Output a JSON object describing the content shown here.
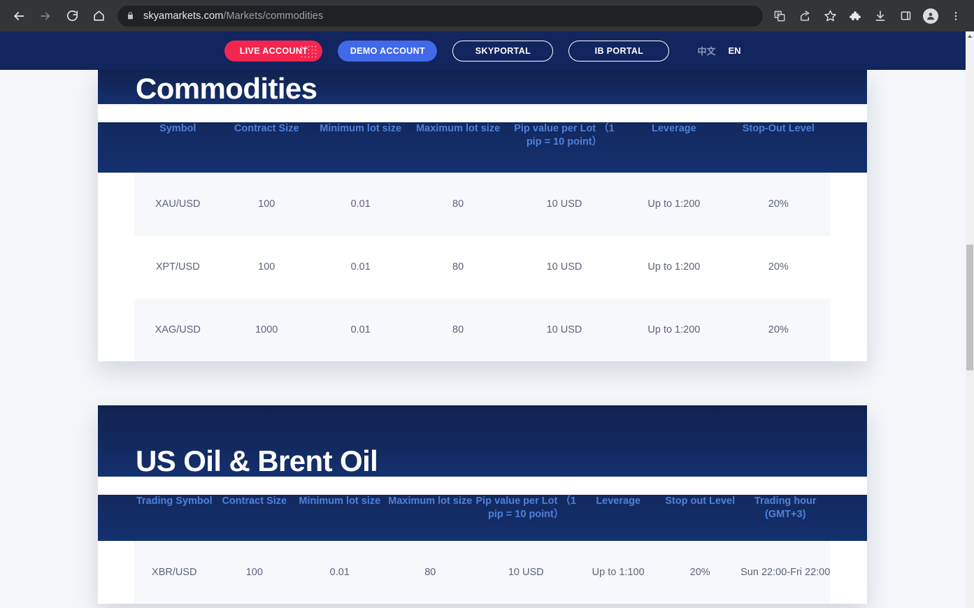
{
  "browser": {
    "back_icon": "back-arrow-icon",
    "forward_icon": "forward-arrow-icon",
    "reload_icon": "reload-icon",
    "home_icon": "home-icon",
    "lock_icon": "lock-icon",
    "url_host": "skyamarkets.com",
    "url_path": "/Markets/commodities",
    "url_full": "skyamarkets.com/Markets/commodities",
    "toolbar_icons": [
      "translate-icon",
      "share-icon",
      "bookmark-star-icon",
      "extensions-puzzle-icon",
      "downloads-icon",
      "side-panel-icon",
      "profile-avatar-icon",
      "three-dot-menu-icon"
    ]
  },
  "site_nav": {
    "buttons": [
      {
        "label": "LIVE ACCOUNT",
        "style": "live"
      },
      {
        "label": "DEMO ACCOUNT",
        "style": "demo"
      },
      {
        "label": "SKYPORTAL",
        "style": "outline"
      },
      {
        "label": "IB PORTAL",
        "style": "outline"
      }
    ],
    "languages": [
      {
        "label": "中文",
        "active": false
      },
      {
        "label": "EN",
        "active": true
      }
    ],
    "background_color": "#12255f"
  },
  "colors": {
    "brand_dark_blue": "#13295e",
    "accent_red": "#f4264f",
    "accent_blue": "#4169e8",
    "header_text_blue": "#4f80d8",
    "cell_text": "#5b6379",
    "page_background": "#f4f6fa",
    "row_alt_background": "#f6f8fc"
  },
  "sections": [
    {
      "id": "commodities",
      "title": "Commodities",
      "columns": [
        "Symbol",
        "Contract Size",
        "Minimum lot size",
        "Maximum lot size",
        "Pip value per Lot （1 pip = 10 point）",
        "Leverage",
        "Stop-Out Level"
      ],
      "rows": [
        [
          "XAU/USD",
          "100",
          "0.01",
          "80",
          "10 USD",
          "Up to 1:200",
          "20%"
        ],
        [
          "XPT/USD",
          "100",
          "0.01",
          "80",
          "10 USD",
          "Up to 1:200",
          "20%"
        ],
        [
          "XAG/USD",
          "1000",
          "0.01",
          "80",
          "10 USD",
          "Up to 1:200",
          "20%"
        ]
      ]
    },
    {
      "id": "oil",
      "title": "US Oil & Brent Oil",
      "columns": [
        "Trading Symbol",
        "Contract Size",
        "Minimum lot size",
        "Maximum lot size",
        "Pip value per Lot （1 pip = 10 point）",
        "Leverage",
        "Stop out Level",
        "Trading hour (GMT+3)"
      ],
      "rows": [
        [
          "XBR/USD",
          "100",
          "0.01",
          "80",
          "10 USD",
          "Up to 1:100",
          "20%",
          "Sun 22:00-Fri 22:00"
        ]
      ]
    }
  ],
  "scrollbar": {
    "up_arrow_icon": "scroll-up-arrow-icon",
    "thumb_label": "scroll-thumb"
  }
}
